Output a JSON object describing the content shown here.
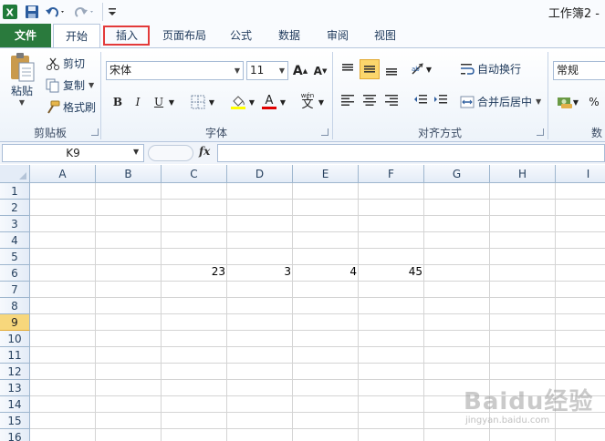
{
  "window": {
    "title": "工作簿2 -"
  },
  "tabs": [
    {
      "id": "file",
      "label": "文件"
    },
    {
      "id": "home",
      "label": "开始"
    },
    {
      "id": "insert",
      "label": "插入"
    },
    {
      "id": "layout",
      "label": "页面布局"
    },
    {
      "id": "formulas",
      "label": "公式"
    },
    {
      "id": "data",
      "label": "数据"
    },
    {
      "id": "review",
      "label": "审阅"
    },
    {
      "id": "view",
      "label": "视图"
    }
  ],
  "ribbon": {
    "clipboard": {
      "paste": "粘贴",
      "cut": "剪切",
      "copy": "复制",
      "format_painter": "格式刷",
      "group": "剪贴板"
    },
    "font": {
      "name": "宋体",
      "size": "11",
      "bold": "B",
      "italic": "I",
      "underline": "U",
      "font_color_glyph": "A",
      "grow_glyph": "A",
      "shrink_glyph": "A",
      "phonetic_glyph": "文",
      "phonetic_sup": "wén",
      "group": "字体"
    },
    "alignment": {
      "wrap": "自动换行",
      "merge": "合并后居中",
      "group": "对齐方式"
    },
    "number": {
      "format": "常规",
      "percent": "%",
      "group": "数"
    }
  },
  "formula_bar": {
    "name_box": "K9",
    "fx": "fx",
    "content": ""
  },
  "grid": {
    "columns": [
      "A",
      "B",
      "C",
      "D",
      "E",
      "F",
      "G",
      "H",
      "I"
    ],
    "rows": [
      "1",
      "2",
      "3",
      "4",
      "5",
      "6",
      "7",
      "8",
      "9",
      "10",
      "11",
      "12",
      "13",
      "14",
      "15",
      "16"
    ],
    "active_row": "9",
    "cells": [
      {
        "ref": "C6",
        "value": "23"
      },
      {
        "ref": "D6",
        "value": "3"
      },
      {
        "ref": "E6",
        "value": "4"
      },
      {
        "ref": "F6",
        "value": "45"
      }
    ]
  },
  "watermark": {
    "logo": "Baidu经验",
    "url": "jingyan.baidu.com"
  },
  "colors": {
    "file_tab": "#2a7a3d",
    "highlight": "#e33a3a",
    "active_row": "#f7d77c"
  }
}
